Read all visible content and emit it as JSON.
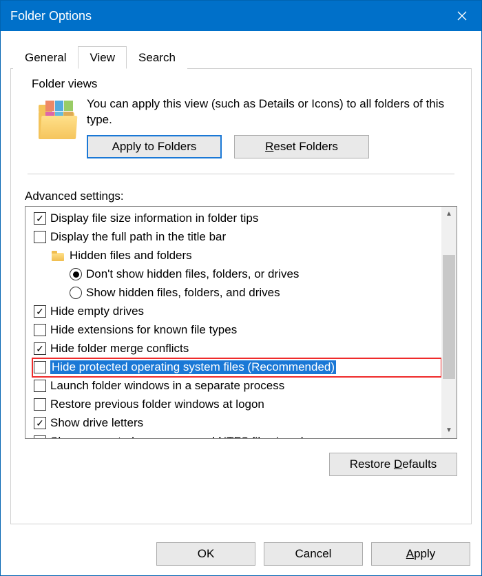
{
  "title": "Folder Options",
  "tabs": {
    "general": "General",
    "view": "View",
    "search": "Search",
    "active": "view"
  },
  "folder_views": {
    "group_label": "Folder views",
    "desc": "You can apply this view (such as Details or Icons) to all folders of this type.",
    "apply_label": "Apply to Folders",
    "reset_prefix": "R",
    "reset_suffix": "eset Folders"
  },
  "advanced": {
    "label": "Advanced settings:",
    "items": [
      {
        "type": "checkbox",
        "checked": true,
        "label": "Display file size information in folder tips"
      },
      {
        "type": "checkbox",
        "checked": false,
        "label": "Display the full path in the title bar"
      },
      {
        "type": "tree",
        "label": "Hidden files and folders"
      },
      {
        "type": "radio",
        "checked": true,
        "label": "Don't show hidden files, folders, or drives"
      },
      {
        "type": "radio",
        "checked": false,
        "label": "Show hidden files, folders, and drives"
      },
      {
        "type": "checkbox",
        "checked": true,
        "label": "Hide empty drives"
      },
      {
        "type": "checkbox",
        "checked": false,
        "label": "Hide extensions for known file types"
      },
      {
        "type": "checkbox",
        "checked": true,
        "label": "Hide folder merge conflicts"
      },
      {
        "type": "checkbox",
        "checked": false,
        "label": "Hide protected operating system files (Recommended)",
        "selected": true,
        "highlight": true
      },
      {
        "type": "checkbox",
        "checked": false,
        "label": "Launch folder windows in a separate process"
      },
      {
        "type": "checkbox",
        "checked": false,
        "label": "Restore previous folder windows at logon"
      },
      {
        "type": "checkbox",
        "checked": true,
        "label": "Show drive letters"
      },
      {
        "type": "checkbox",
        "checked": false,
        "label": "Show encrypted or compressed NTFS files in color"
      }
    ],
    "restore_prefix": "Restore ",
    "restore_suffix": "efaults",
    "restore_mnemonic": "D"
  },
  "footer": {
    "ok": "OK",
    "cancel": "Cancel",
    "apply_prefix": "A",
    "apply_suffix": "pply"
  }
}
